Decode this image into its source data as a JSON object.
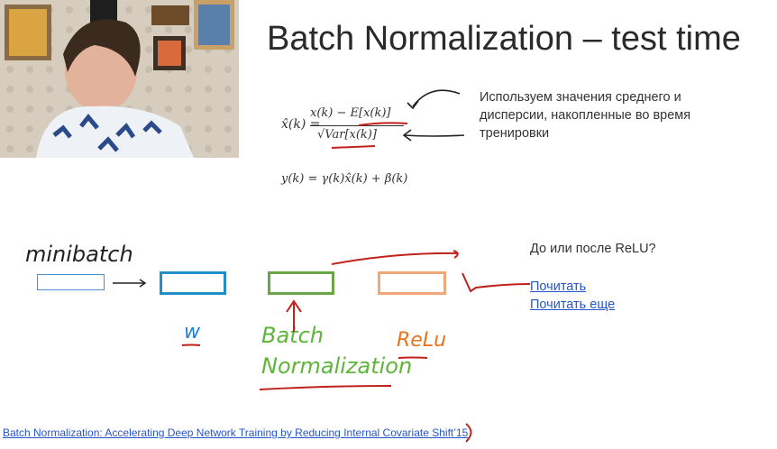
{
  "slide": {
    "title": "Batch Normalization – test time",
    "formula_norm": {
      "lhs": "x̂(k) =",
      "numerator": "x(k) − E[x(k)]",
      "denominator": "√Var[x(k)]"
    },
    "formula_scale": "y(k) = γ(k)x̂(k) + β(k)",
    "note": "Используем значения среднего и дисперсии, накопленные во время тренировки",
    "question": "До или после ReLU?",
    "links": [
      {
        "label": "Почитать"
      },
      {
        "label": "Почитать еще"
      }
    ],
    "paper_link": "Batch Normalization: Accelerating Deep Network Training by Reducing Internal Covariate Shift’15"
  },
  "handwriting": {
    "minibatch": "minibatch",
    "w": "w",
    "batch": "Batch",
    "normalization": "Normalization",
    "relu": "ReLu"
  },
  "colors": {
    "box_input": "#4a8fd0",
    "box_w": "#1f8fc9",
    "box_bn": "#6ba547",
    "box_relu": "#f0a87a",
    "ink_red": "#c0221b",
    "ink_green": "#5fb53a",
    "ink_orange": "#e8741e",
    "link": "#2557c9"
  }
}
